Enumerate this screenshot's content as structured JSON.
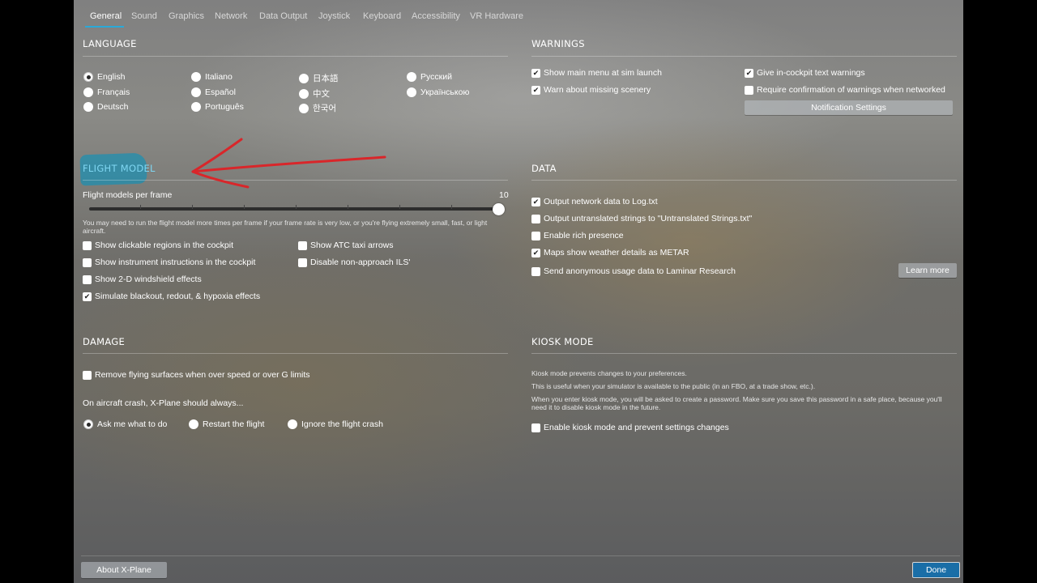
{
  "tabs": [
    "General",
    "Sound",
    "Graphics",
    "Network",
    "Data Output",
    "Joystick",
    "Keyboard",
    "Accessibility",
    "VR Hardware"
  ],
  "active_tab": "General",
  "language": {
    "title": "LANGUAGE",
    "options": [
      "English",
      "Italiano",
      "日本語",
      "Русский",
      "Français",
      "Español",
      "中文",
      "Українською",
      "Deutsch",
      "Português",
      "한국어"
    ],
    "selected": "English"
  },
  "warnings": {
    "title": "WARNINGS",
    "show_main_menu": "Show main menu at sim launch",
    "warn_missing_scenery": "Warn about missing scenery",
    "give_incockpit": "Give in-cockpit text warnings",
    "require_confirmation": "Require confirmation of warnings when networked",
    "notification_button": "Notification Settings",
    "checked": {
      "show_main_menu": true,
      "warn_missing_scenery": true,
      "give_incockpit": true,
      "require_confirmation": false
    }
  },
  "flight_model": {
    "title": "FLIGHT MODEL",
    "fpf_label": "Flight models per frame",
    "fpf_value": "10",
    "slider_fraction": 1.0,
    "hint": "You may need to run the flight model more times per frame if your frame rate is very low, or you're flying extremely small, fast, or light aircraft.",
    "opt_clickable": "Show clickable regions in the cockpit",
    "opt_instrument": "Show instrument instructions in the cockpit",
    "opt_windshield": "Show 2-D windshield effects",
    "opt_blackout": "Simulate blackout, redout, & hypoxia effects",
    "opt_atc_taxi": "Show ATC taxi arrows",
    "opt_ils": "Disable non-approach ILS'",
    "checked": {
      "opt_clickable": false,
      "opt_instrument": false,
      "opt_windshield": false,
      "opt_blackout": true,
      "opt_atc_taxi": false,
      "opt_ils": false
    }
  },
  "data": {
    "title": "DATA",
    "opt_network": "Output network data to Log.txt",
    "opt_untranslated": "Output untranslated strings to \"Untranslated Strings.txt\"",
    "opt_rich": "Enable rich presence",
    "opt_metar": "Maps show weather details as METAR",
    "opt_anonymous": "Send anonymous usage data to Laminar Research",
    "learn_more": "Learn more",
    "checked": {
      "opt_network": true,
      "opt_untranslated": false,
      "opt_rich": false,
      "opt_metar": true,
      "opt_anonymous": false
    }
  },
  "damage": {
    "title": "DAMAGE",
    "opt_remove_surfaces": "Remove flying surfaces when over speed or over G limits",
    "crash_prompt": "On aircraft crash, X-Plane should always...",
    "crash_options": [
      "Ask me what to do",
      "Restart the flight",
      "Ignore the flight crash"
    ],
    "crash_selected": "Ask me what to do",
    "checked": {
      "opt_remove_surfaces": false
    }
  },
  "kiosk": {
    "title": "KIOSK MODE",
    "line1": "Kiosk mode prevents changes to your preferences.",
    "line2": "This is useful when your simulator is available to the public (in an FBO, at a trade show, etc.).",
    "line3": "When you enter kiosk mode, you will be asked to create a password. Make sure you save this password in a safe place, because you'll need it to disable kiosk mode in the future.",
    "opt_enable": "Enable kiosk mode and prevent settings changes",
    "checked": {
      "opt_enable": false
    }
  },
  "footer": {
    "about": "About X-Plane",
    "done": "Done"
  },
  "colors": {
    "accent": "#2aa9d8",
    "annotation_arrow": "#d9262a",
    "highlight": "#1f8fb0",
    "done_button": "#1a6ea7"
  }
}
